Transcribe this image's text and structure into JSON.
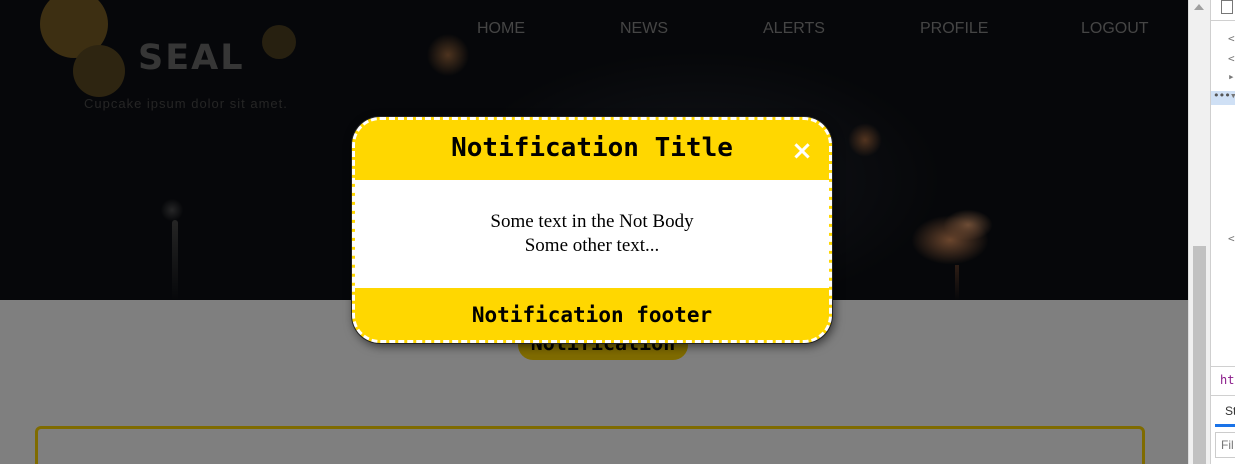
{
  "site": {
    "logo": "SEAL",
    "tagline": "Cupcake ipsum dolor sit amet."
  },
  "nav": {
    "home": "HOME",
    "news": "NEWS",
    "alerts": "ALERTS",
    "profile": "PROFILE",
    "logout": "LOGOUT"
  },
  "page": {
    "notification_button": "Notification"
  },
  "modal": {
    "title": "Notification Title",
    "close_symbol": "×",
    "body_line1": "Some text in the Not Body",
    "body_line2": "Some other text...",
    "footer": "Notification footer"
  },
  "devtools": {
    "code_lines": [
      "<",
      "<",
      "▸",
      "▾",
      "<"
    ],
    "dots": "•••",
    "html_tab_fragment": "ht",
    "styles_tab_fragment": "St",
    "filter_fragment": "Fil"
  },
  "colors": {
    "accent": "#ffd700",
    "overlay": "rgba(0,0,0,0.5)",
    "modal_border": "#ffffff"
  }
}
